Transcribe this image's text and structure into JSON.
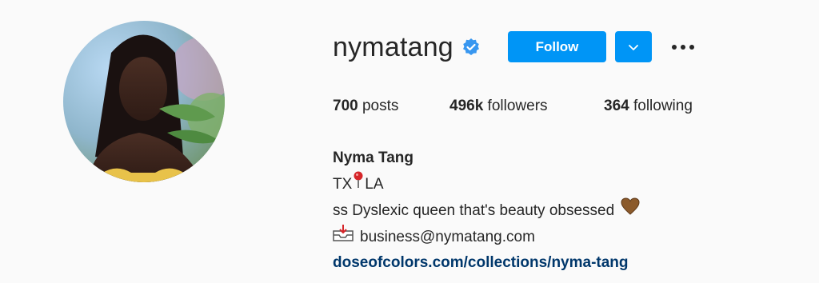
{
  "profile": {
    "username": "nymatang",
    "verified": true,
    "follow_label": "Follow",
    "avatar_icon": "profile-photo",
    "verified_icon": "verified-badge-icon",
    "dropdown_icon": "chevron-down-icon",
    "more_icon": "more-options-icon"
  },
  "stats": {
    "posts_count": "700",
    "posts_label": " posts",
    "followers_count": "496k",
    "followers_label": " followers",
    "following_count": "364",
    "following_label": " following"
  },
  "bio": {
    "name": "Nyma Tang",
    "location_left": "TX",
    "location_right": "LA",
    "location_icon": "pin-icon",
    "description": "ss Dyslexic queen that's beauty obsessed",
    "heart_icon": "brown-heart-icon",
    "email_icon": "inbox-tray-icon",
    "email": "business@nymatang.com",
    "link": "doseofcolors.com/collections/nyma-tang"
  },
  "colors": {
    "primary_button": "#0095f6",
    "link": "#00376b",
    "text": "#262626",
    "background": "#fafafa"
  }
}
